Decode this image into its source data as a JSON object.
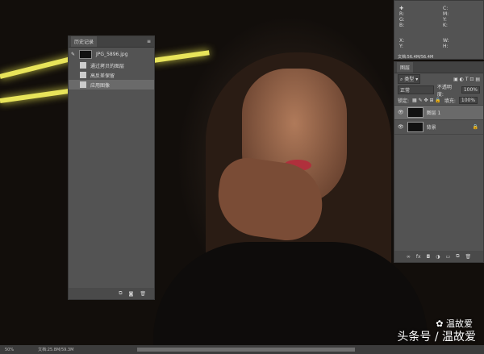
{
  "history": {
    "title": "历史记录",
    "snapshot": "JPG_5896.jpg",
    "steps": [
      "通过拷贝的图层",
      "高反差保留",
      "应用图像"
    ],
    "selected_index": 2
  },
  "info": {
    "r": "R:",
    "g": "G:",
    "b": "B:",
    "c": "C:",
    "m": "M:",
    "y": "Y:",
    "k": "K:",
    "x": "X:",
    "yy": "Y:",
    "w": "W:",
    "h": "H:",
    "doc": "文档:56.4M/56.4M"
  },
  "layers": {
    "title": "图层",
    "filter": "类型",
    "blend": "正常",
    "opacity_label": "不透明度:",
    "opacity": "100%",
    "lock_label": "锁定:",
    "fill_label": "填充:",
    "fill": "100%",
    "items": [
      {
        "name": "图层 1",
        "selected": true
      },
      {
        "name": "背景",
        "locked": true
      }
    ]
  },
  "status": {
    "zoom": "50%",
    "doc": "文档:25.8M/59.3M"
  },
  "watermark": {
    "line1": "温故爱",
    "line2": "头条号 / 温故爱"
  }
}
